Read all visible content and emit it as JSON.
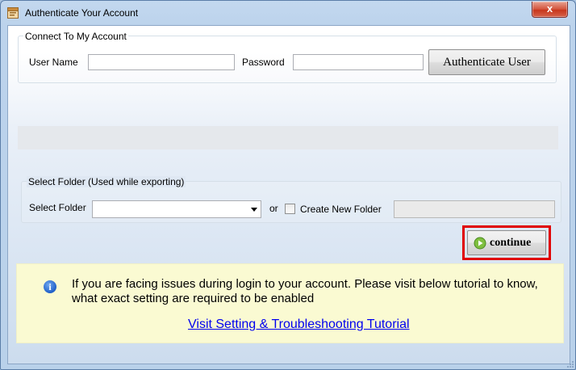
{
  "window": {
    "title": "Authenticate Your Account",
    "close_glyph": "x",
    "app_icon": "window-app-icon"
  },
  "connect_group": {
    "legend": "Connect To My Account",
    "username_label": "User Name",
    "username_value": "",
    "password_label": "Password",
    "password_value": "",
    "authenticate_button": "Authenticate User"
  },
  "folder_group": {
    "legend": "Select Folder (Used while exporting)",
    "select_label": "Select Folder",
    "selected_value": "",
    "or_label": "or",
    "create_new_label": "Create New Folder",
    "create_new_checked": false,
    "new_folder_value": ""
  },
  "continue_button": {
    "label": "continue",
    "icon": "play-arrow-icon"
  },
  "info": {
    "icon": "info-icon",
    "icon_glyph": "i",
    "message_line1": "If you are facing issues during login to your account. Please visit below tutorial to know,",
    "message_line2": "what exact setting are required to be enabled",
    "link_text": "Visit Setting & Troubleshooting Tutorial"
  },
  "colors": {
    "highlight": "#e00000",
    "info_background": "#fafad2",
    "link": "#0000ee"
  }
}
